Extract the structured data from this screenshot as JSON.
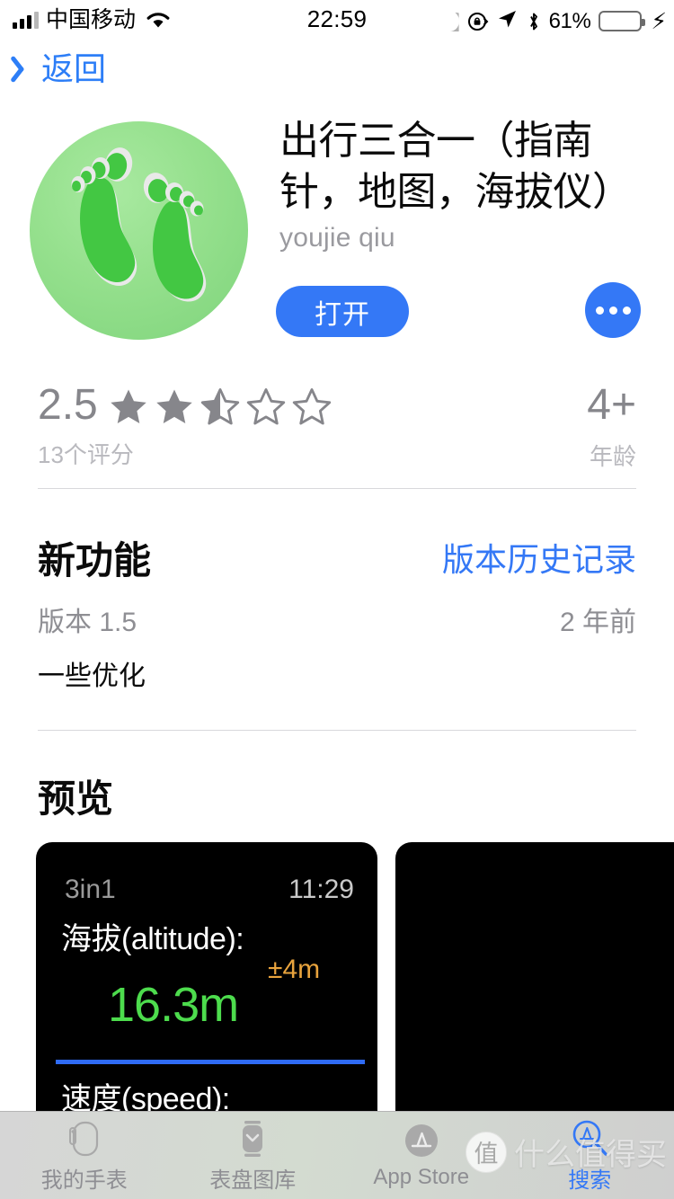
{
  "statusbar": {
    "carrier": "中国移动",
    "time": "22:59",
    "battery_percent": "61%",
    "signal_icon": "signal-bars-icon",
    "wifi_icon": "wifi-icon",
    "moon_icon": "do-not-disturb-moon-icon",
    "rotation_lock_icon": "rotation-lock-icon",
    "location_icon": "location-arrow-icon",
    "bluetooth_icon": "bluetooth-icon",
    "battery_icon": "battery-icon",
    "charging_icon": "lightning-bolt-icon",
    "battery_fill_color": "#6ddc6d"
  },
  "nav": {
    "back_label": "返回",
    "back_icon": "chevron-left-icon",
    "accent_color": "#2d7ef7"
  },
  "app": {
    "title": "出行三合一（指南针，地图，海拔仪）",
    "developer": "youjie qiu",
    "icon_name": "footprints-app-icon",
    "open_label": "打开",
    "more_label": "•••",
    "button_color": "#3478f6"
  },
  "ratings": {
    "score": "2.5",
    "stars_filled": 2.5,
    "count_label": "13个评分",
    "age_value": "4+",
    "age_label": "年龄"
  },
  "whats_new": {
    "heading": "新功能",
    "history_link": "版本历史记录",
    "version": "版本 1.5",
    "date": "2 年前",
    "notes": "一些优化"
  },
  "preview": {
    "heading": "预览",
    "cards": [
      {
        "app_name": "3in1",
        "time": "11:29",
        "altitude_label": "海拔(altitude):",
        "altitude_value": "16.3m",
        "accuracy": "±4m",
        "speed_label": "速度(speed):",
        "value_color": "#4ddc4d",
        "accuracy_color": "#e8a33d",
        "divider_color": "#2f6bf5"
      },
      {
        "app_name": "",
        "time": "",
        "altitude_label": "",
        "altitude_value": "",
        "accuracy": "",
        "speed_label": ""
      }
    ]
  },
  "tabbar": {
    "items": [
      {
        "label": "我的手表",
        "icon": "watch-outline-icon",
        "active": false
      },
      {
        "label": "表盘图库",
        "icon": "watch-face-gallery-icon",
        "active": false
      },
      {
        "label": "App Store",
        "icon": "app-store-icon",
        "active": false
      },
      {
        "label": "搜索",
        "icon": "search-app-store-icon",
        "active": true
      }
    ]
  },
  "watermark": {
    "logo_text": "值",
    "text": "什么值得买"
  }
}
